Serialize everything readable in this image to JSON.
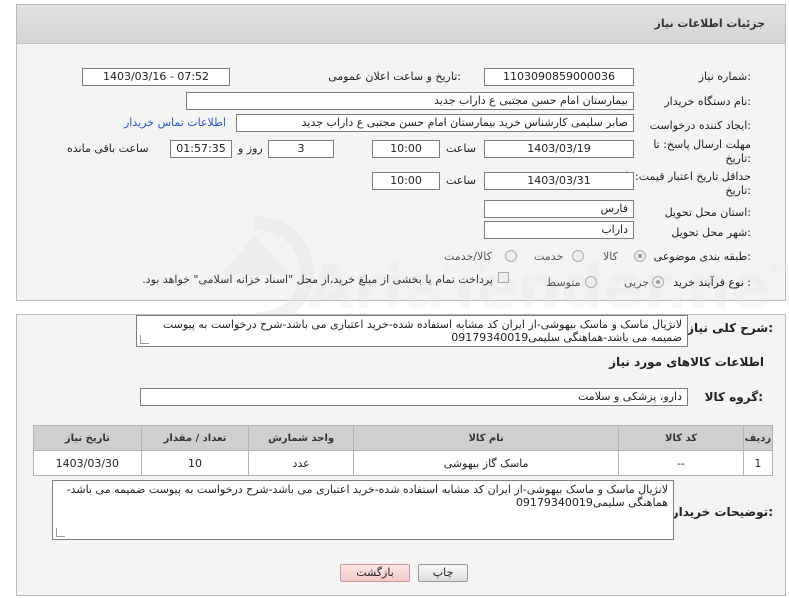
{
  "header": {
    "title": "جزئیات اطلاعات نیاز"
  },
  "form": {
    "need_number_label": "شماره نیاز:",
    "need_number": "1103090859000036",
    "announce_label": "تاریخ و ساعت اعلان عمومی:",
    "announce_value": "1403/03/16 - 07:52",
    "buyer_org_label": "نام دستگاه خریدار:",
    "buyer_org": "بیمارستان امام حسن مجتبی  ع  داراب جدید",
    "creator_label": "ایجاد کننده درخواست:",
    "creator": "صابر سلیمی کارشناس خرید بیمارستان امام حسن مجتبی  ع  داراب جدید",
    "contact_link": "اطلاعات تماس خریدار",
    "deadline_label_1": "مهلت ارسال پاسخ: تا",
    "deadline_label_2": "تاریخ:",
    "deadline_date": "1403/03/19",
    "time_label": "ساعت",
    "deadline_time": "10:00",
    "days_value": "3",
    "days_label": "روز و",
    "remaining_value": "01:57:35",
    "remaining_label": "ساعت باقی مانده",
    "price_validity_label_1": "حداقل تاریخ اعتبار قیمت: تا",
    "price_validity_label_2": "تاریخ:",
    "price_validity_date": "1403/03/31",
    "price_validity_time": "10:00",
    "province_label": "استان محل تحویل:",
    "province": "فارس",
    "city_label": "شهر محل تحویل:",
    "city": "داراب",
    "category_label": "طبقه بندی موضوعی:",
    "category_options": [
      "کالا",
      "خدمت",
      "کالا/خدمت"
    ],
    "purchase_type_label": "نوع فرآیند خرید :",
    "purchase_options": [
      "جزیی",
      "متوسط"
    ],
    "payment_note": "پرداخت تمام یا بخشی از مبلغ خرید،از محل \"اسناد خزانه اسلامی\" خواهد بود."
  },
  "description": {
    "label": "شرح کلی نیاز:",
    "text": "لانژیال ماسک و ماسک بیهوشی-از ایران کد مشابه استفاده شده-خرید اعتباری می باشد-شرح درخواست به پیوست ضمیمه می باشد-هماهنگی سلیمی09179340019"
  },
  "goods": {
    "section_title": "اطلاعات کالاهای مورد نیاز",
    "group_label": "گروه کالا:",
    "group_value": "دارو، پزشکی و سلامت",
    "columns": [
      "ردیف",
      "کد کالا",
      "نام کالا",
      "واحد شمارش",
      "تعداد / مقدار",
      "تاریخ نیاز"
    ],
    "rows": [
      {
        "index": "1",
        "code": "--",
        "name": "ماسک گاز بیهوشی",
        "unit": "عدد",
        "qty": "10",
        "date": "1403/03/30"
      }
    ]
  },
  "buyer_notes": {
    "label": "توضیحات خریدار:",
    "text": "لانژیال ماسک و ماسک بیهوشی-از ایران کد مشابه استفاده شده-خرید اعتباری می باشد-شرح درخواست به پیوست ضمیمه می باشد-هماهنگی سلیمی09179340019"
  },
  "actions": {
    "print": "چاپ",
    "back": "بازگشت"
  },
  "watermark": {
    "text": "AriaTender.neT"
  }
}
